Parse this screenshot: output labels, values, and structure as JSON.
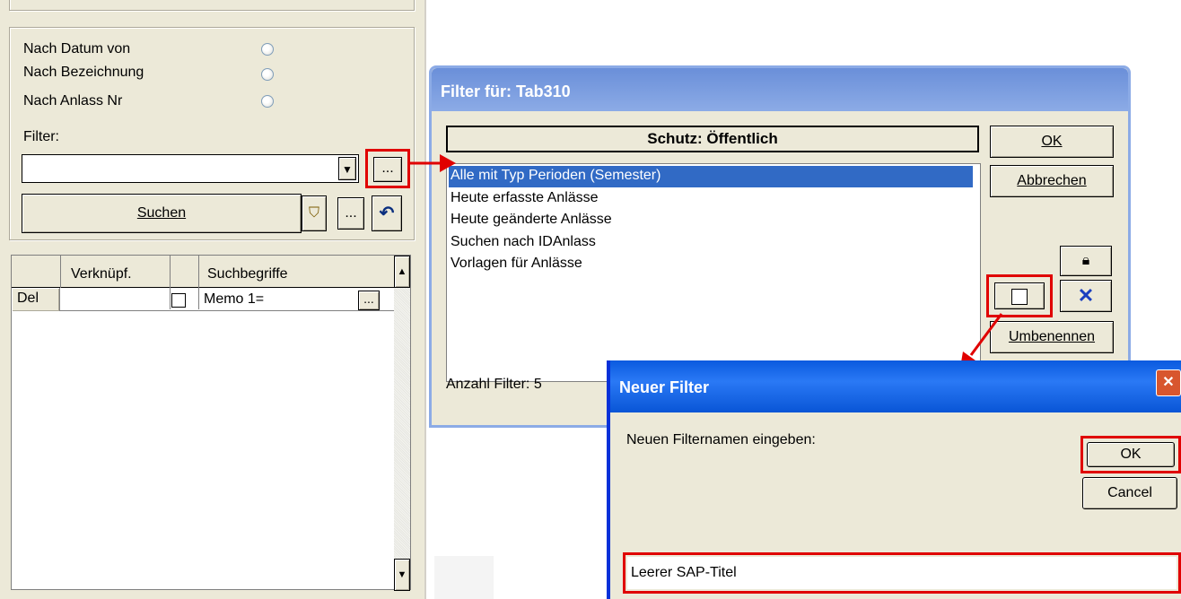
{
  "left": {
    "radios": [
      "Nach Datum von",
      "Nach Bezeichnung",
      "Nach Anlass Nr"
    ],
    "filter_label": "Filter:",
    "browse_label": "...",
    "search_label": "Suchen",
    "more_label": "...",
    "grid": {
      "headers": [
        "Verknüpf.",
        "Suchbegriffe"
      ],
      "row": {
        "del": "Del",
        "value": "Memo 1=",
        "ellipsis": "..."
      }
    }
  },
  "filter_dialog": {
    "title": "Filter für: Tab310",
    "protection": "Schutz: Öffentlich",
    "items": [
      "Alle mit Typ Perioden (Semester)",
      "Heute erfasste Anlässe",
      "Heute geänderte Anlässe",
      "Suchen nach IDAnlass",
      "Vorlagen für Anlässe"
    ],
    "selected_index": 0,
    "ok_label": "OK",
    "cancel_label": "Abbrechen",
    "rename_label": "Umbenennen",
    "count_text": "Anzahl Filter: 5"
  },
  "new_filter_dialog": {
    "title": "Neuer Filter",
    "prompt": "Neuen Filternamen eingeben:",
    "ok_label": "OK",
    "cancel_label": "Cancel",
    "input_value": "Leerer SAP-Titel"
  },
  "colors": {
    "highlight_red": "#e00000",
    "selection_blue": "#316ac5"
  }
}
